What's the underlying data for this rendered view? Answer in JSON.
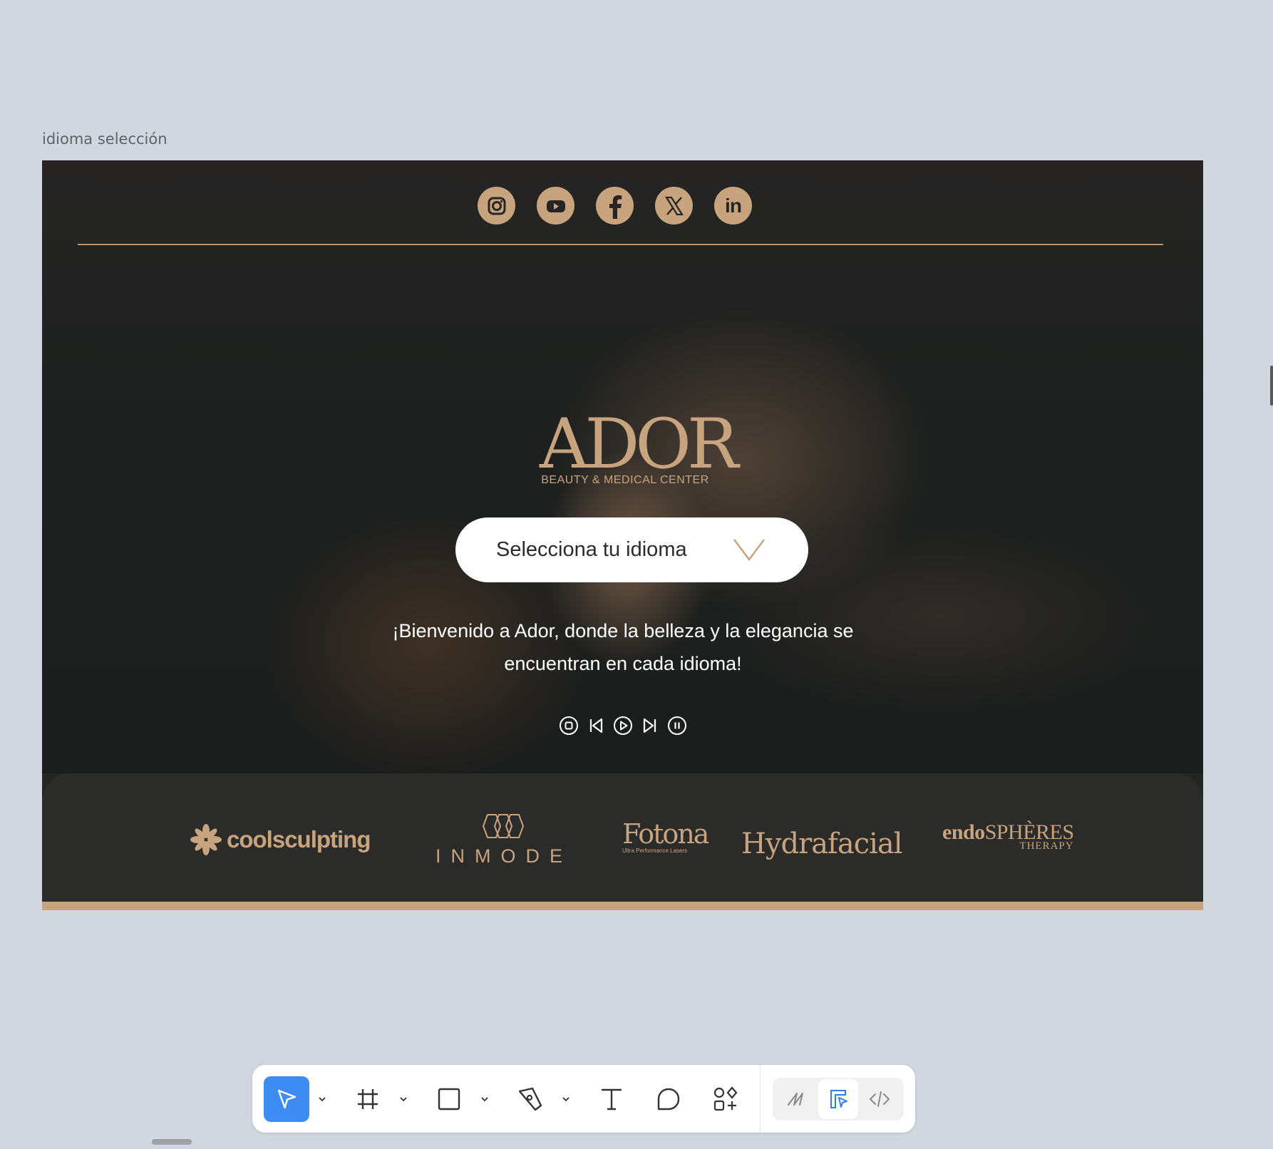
{
  "canvas": {
    "frame_label": "idioma selección"
  },
  "social": [
    {
      "name": "instagram",
      "icon": "instagram-icon"
    },
    {
      "name": "youtube",
      "icon": "youtube-icon"
    },
    {
      "name": "facebook",
      "icon": "facebook-icon"
    },
    {
      "name": "x",
      "icon": "x-icon"
    },
    {
      "name": "linkedin",
      "icon": "linkedin-icon",
      "text": "in"
    }
  ],
  "brand": {
    "logo": "ADOR",
    "tagline": "BEAUTY & MEDICAL CENTER"
  },
  "language_select": {
    "label": "Selecciona tu idioma",
    "icon": "chevron-down-icon"
  },
  "welcome": {
    "line1": "¡Bienvenido a Ador, donde la belleza y la elegancia se",
    "line2": "encuentran en cada idioma!"
  },
  "media_controls": [
    "stop-icon",
    "skip-back-icon",
    "play-icon",
    "skip-forward-icon",
    "pause-icon"
  ],
  "partners": {
    "coolsculpting": "coolsculpting",
    "inmode": "INMODE",
    "fotona": "Fotona",
    "fotona_sub": "Ultra Performance Lasers",
    "hydrafacial": "Hydrafacial",
    "endo_a": "endo",
    "endo_b": "SPHÈRES",
    "endo_sub": "THERAPY"
  },
  "colors": {
    "gold": "#c8a47e",
    "dark": "#252523",
    "toolbar_accent": "#3d8cf4",
    "canvas_bg": "#d2d6de"
  },
  "toolbar": {
    "tools": [
      "move-icon",
      "frame-icon",
      "rectangle-icon",
      "pen-icon",
      "text-icon",
      "comment-icon",
      "actions-icon"
    ],
    "modes": [
      "draw-mode-icon",
      "design-mode-icon",
      "dev-mode-icon"
    ]
  }
}
